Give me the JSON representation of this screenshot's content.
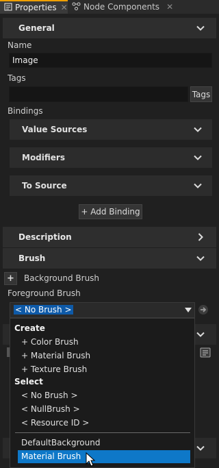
{
  "tabs": [
    {
      "label": "Properties",
      "close": "✕"
    },
    {
      "label": "Node Components",
      "close": "✕"
    }
  ],
  "general": {
    "title": "General",
    "name_label": "Name",
    "name_value": "Image",
    "tags_label": "Tags",
    "tags_value": "",
    "tags_button": "Tags",
    "bindings_label": "Bindings",
    "value_sources": "Value Sources",
    "modifiers": "Modifiers",
    "to_source": "To Source",
    "add_binding": "+ Add Binding"
  },
  "description": {
    "title": "Description"
  },
  "brush": {
    "title": "Brush",
    "add_symbol": "+",
    "background_label": "Background Brush",
    "foreground_label": "Foreground Brush",
    "foreground_value": "< No Brush >"
  },
  "dropdown": {
    "create_header": "Create",
    "create_items": [
      "+ Color Brush",
      "+ Material Brush",
      "+ Texture Brush"
    ],
    "select_header": "Select",
    "select_items": [
      "< No Brush >",
      "< NullBrush >",
      "< Resource ID >"
    ],
    "resources": [
      "DefaultBackground",
      "Material Brush"
    ],
    "selected": "Material Brush"
  },
  "colors": {
    "accent": "#f0a000",
    "selection": "#0e78c8",
    "highlight_text_bg": "#0e5aa8"
  }
}
